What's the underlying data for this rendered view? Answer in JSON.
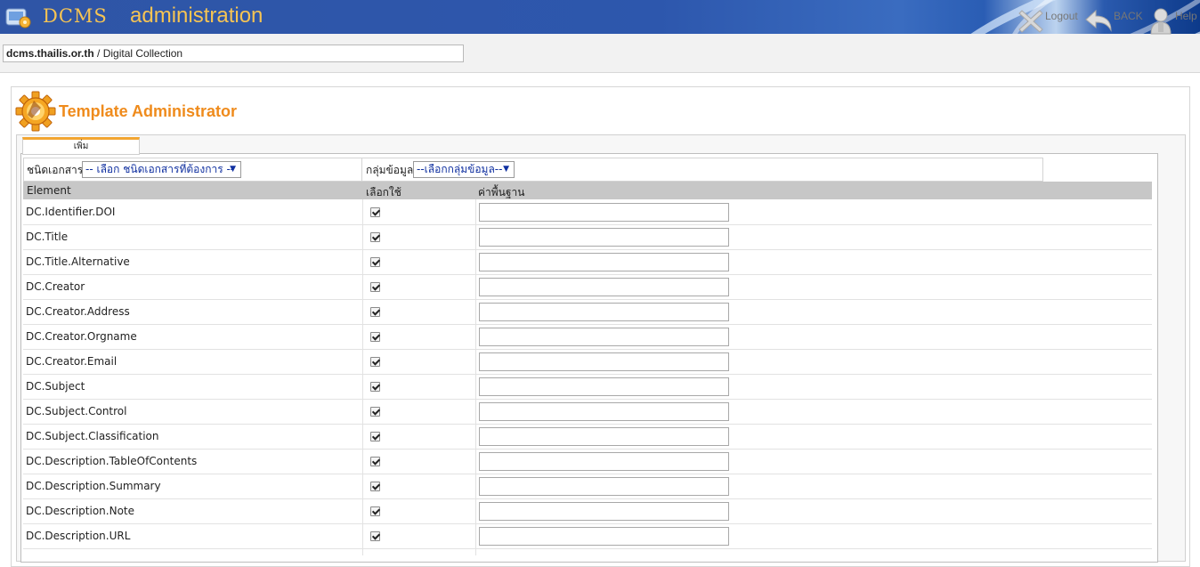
{
  "header": {
    "brand": "DCMS",
    "brand_sub": "administration"
  },
  "addressbar": {
    "host": "dcms.thailis.or.th",
    "path": " / Digital Collection"
  },
  "topnav": {
    "logout": "Logout",
    "back": "BACK",
    "help": "Help"
  },
  "page": {
    "title": "Template Administrator",
    "tab_label": "เพิ่ม"
  },
  "filters": {
    "doc_type_label": "ชนิดเอกสาร",
    "doc_type_value": "-- เลือก ชนิดเอกสารที่ต้องการ --",
    "group_label": "กลุ่มข้อมูล",
    "group_value": "--เลือกกลุ่มข้อมูล--"
  },
  "table": {
    "headers": [
      "Element",
      "เลือกใช้",
      "ค่าพื้นฐาน"
    ],
    "rows": [
      {
        "element": "DC.Identifier.DOI",
        "checked": true,
        "value": ""
      },
      {
        "element": "DC.Title",
        "checked": true,
        "value": ""
      },
      {
        "element": "DC.Title.Alternative",
        "checked": true,
        "value": ""
      },
      {
        "element": "DC.Creator",
        "checked": true,
        "value": ""
      },
      {
        "element": "DC.Creator.Address",
        "checked": true,
        "value": ""
      },
      {
        "element": "DC.Creator.Orgname",
        "checked": true,
        "value": ""
      },
      {
        "element": "DC.Creator.Email",
        "checked": true,
        "value": ""
      },
      {
        "element": "DC.Subject",
        "checked": true,
        "value": ""
      },
      {
        "element": "DC.Subject.Control",
        "checked": true,
        "value": ""
      },
      {
        "element": "DC.Subject.Classification",
        "checked": true,
        "value": ""
      },
      {
        "element": "DC.Description.TableOfContents",
        "checked": true,
        "value": ""
      },
      {
        "element": "DC.Description.Summary",
        "checked": true,
        "value": ""
      },
      {
        "element": "DC.Description.Note",
        "checked": true,
        "value": ""
      },
      {
        "element": "DC.Description.URL",
        "checked": true,
        "value": ""
      }
    ]
  },
  "icons": {
    "logo": "app-logo-icon",
    "logout": "logout-x-icon",
    "back": "back-arrow-icon",
    "help": "help-person-icon",
    "title": "gear-icon"
  },
  "colors": {
    "banner": "#2d57ad",
    "brand_text": "#f6c453",
    "title": "#ef8b1c",
    "tab_accent": "#f2a531",
    "table_header": "#c7c7c7"
  }
}
